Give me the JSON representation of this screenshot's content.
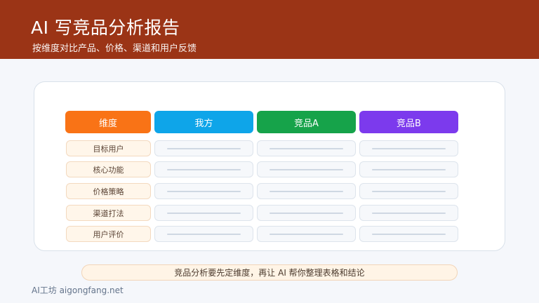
{
  "header": {
    "title": "AI 写竞品分析报告",
    "subtitle": "按维度对比产品、价格、渠道和用户反馈"
  },
  "table": {
    "columns": [
      {
        "label": "维度",
        "color": "#f97316"
      },
      {
        "label": "我方",
        "color": "#0ea5e9"
      },
      {
        "label": "竞品A",
        "color": "#16a34a"
      },
      {
        "label": "竞品B",
        "color": "#7c3aed"
      }
    ],
    "rows": [
      "目标用户",
      "核心功能",
      "价格策略",
      "渠道打法",
      "用户评价"
    ]
  },
  "note": "竞品分析要先定维度，再让 AI 帮你整理表格和结论",
  "footer": "AI工坊 aigongfang.net"
}
